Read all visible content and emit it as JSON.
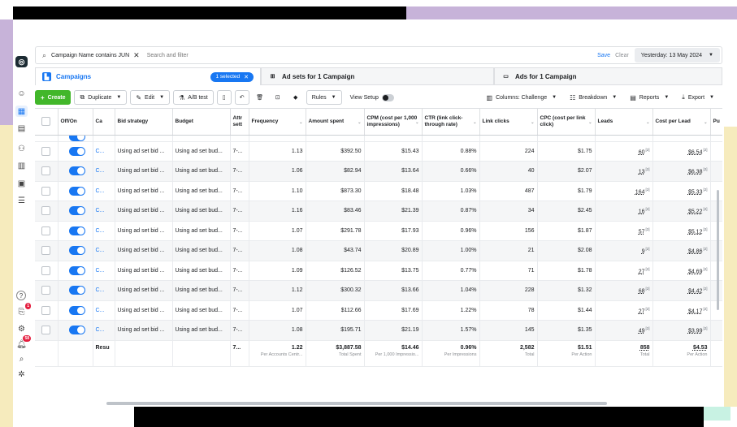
{
  "filter": {
    "chip": "Campaign Name contains JUN",
    "placeholder": "Search and filter",
    "save": "Save",
    "clear": "Clear",
    "date": "Yesterday: 13 May 2024"
  },
  "tabs": {
    "campaigns": "Campaigns",
    "selected": "1 selected",
    "adsets": "Ad sets for 1 Campaign",
    "ads": "Ads for 1 Campaign"
  },
  "toolbar": {
    "create": "Create",
    "duplicate": "Duplicate",
    "edit": "Edit",
    "ab_test": "A/B test",
    "rules": "Rules",
    "view_setup": "View Setup",
    "columns": "Columns: Challenge",
    "breakdown": "Breakdown",
    "reports": "Reports",
    "export": "Export"
  },
  "columns": {
    "offon": "Off/On",
    "campaign": "Ca",
    "bid": "Bid strategy",
    "budget": "Budget",
    "attr": "Attr sett",
    "frequency": "Frequency",
    "amount": "Amount spent",
    "cpm": "CPM (cost per 1,000 impressions)",
    "ctr": "CTR (link click-through rate)",
    "clicks": "Link clicks",
    "cpc": "CPC (cost per link click)",
    "leads": "Leads",
    "cpl": "Cost per Lead",
    "pu": "Pu"
  },
  "rows": [
    {
      "campaign": "C...",
      "bid": "Using ad set bid ...",
      "budget": "Using ad set bud...",
      "attr": "7-...",
      "frequency": "1.13",
      "amount": "$392.50",
      "cpm": "$15.43",
      "ctr": "0.88%",
      "clicks": "224",
      "cpc": "$1.75",
      "leads": "60",
      "cpl": "$6.54"
    },
    {
      "campaign": "C...",
      "bid": "Using ad set bid ...",
      "budget": "Using ad set bud...",
      "attr": "7-...",
      "frequency": "1.06",
      "amount": "$82.94",
      "cpm": "$13.64",
      "ctr": "0.66%",
      "clicks": "40",
      "cpc": "$2.07",
      "leads": "13",
      "cpl": "$6.38"
    },
    {
      "campaign": "C...",
      "bid": "Using ad set bid ...",
      "budget": "Using ad set bud...",
      "attr": "7-...",
      "frequency": "1.10",
      "amount": "$873.30",
      "cpm": "$18.48",
      "ctr": "1.03%",
      "clicks": "487",
      "cpc": "$1.79",
      "leads": "164",
      "cpl": "$5.33"
    },
    {
      "campaign": "C...",
      "bid": "Using ad set bid ...",
      "budget": "Using ad set bud...",
      "attr": "7-...",
      "frequency": "1.16",
      "amount": "$83.46",
      "cpm": "$21.39",
      "ctr": "0.87%",
      "clicks": "34",
      "cpc": "$2.45",
      "leads": "16",
      "cpl": "$5.22"
    },
    {
      "campaign": "C...",
      "bid": "Using ad set bid ...",
      "budget": "Using ad set bud...",
      "attr": "7-...",
      "frequency": "1.07",
      "amount": "$291.78",
      "cpm": "$17.93",
      "ctr": "0.96%",
      "clicks": "156",
      "cpc": "$1.87",
      "leads": "57",
      "cpl": "$5.12"
    },
    {
      "campaign": "C...",
      "bid": "Using ad set bid ...",
      "budget": "Using ad set bud...",
      "attr": "7-...",
      "frequency": "1.08",
      "amount": "$43.74",
      "cpm": "$20.89",
      "ctr": "1.00%",
      "clicks": "21",
      "cpc": "$2.08",
      "leads": "9",
      "cpl": "$4.86"
    },
    {
      "campaign": "C...",
      "bid": "Using ad set bid ...",
      "budget": "Using ad set bud...",
      "attr": "7-...",
      "frequency": "1.09",
      "amount": "$126.52",
      "cpm": "$13.75",
      "ctr": "0.77%",
      "clicks": "71",
      "cpc": "$1.78",
      "leads": "27",
      "cpl": "$4.69"
    },
    {
      "campaign": "C...",
      "bid": "Using ad set bid ...",
      "budget": "Using ad set bud...",
      "attr": "7-...",
      "frequency": "1.12",
      "amount": "$300.32",
      "cpm": "$13.66",
      "ctr": "1.04%",
      "clicks": "228",
      "cpc": "$1.32",
      "leads": "68",
      "cpl": "$4.42"
    },
    {
      "campaign": "C...",
      "bid": "Using ad set bid ...",
      "budget": "Using ad set bud...",
      "attr": "7-...",
      "frequency": "1.07",
      "amount": "$112.66",
      "cpm": "$17.69",
      "ctr": "1.22%",
      "clicks": "78",
      "cpc": "$1.44",
      "leads": "27",
      "cpl": "$4.17"
    },
    {
      "campaign": "C...",
      "bid": "Using ad set bid ...",
      "budget": "Using ad set bud...",
      "attr": "7-...",
      "frequency": "1.08",
      "amount": "$195.71",
      "cpm": "$21.19",
      "ctr": "1.57%",
      "clicks": "145",
      "cpc": "$1.35",
      "leads": "49",
      "cpl": "$3.99"
    }
  ],
  "summary": {
    "campaign": "Resu",
    "attr": "7...",
    "frequency": "1.22",
    "frequency_sub": "Per Accounts Centr...",
    "amount": "$3,887.58",
    "amount_sub": "Total Spent",
    "cpm": "$14.46",
    "cpm_sub": "Per 1,000 Impressio...",
    "ctr": "0.96%",
    "ctr_sub": "Per Impressions",
    "clicks": "2,582",
    "clicks_sub": "Total",
    "cpc": "$1.51",
    "cpc_sub": "Per Action",
    "leads": "858",
    "leads_sub": "Total",
    "cpl": "$4.53",
    "cpl_sub": "Per Action"
  },
  "rail": {
    "notif_badge": "1",
    "alerts_badge": "58"
  },
  "colors": {
    "accent": "#1877f2",
    "create": "#42b72a"
  }
}
